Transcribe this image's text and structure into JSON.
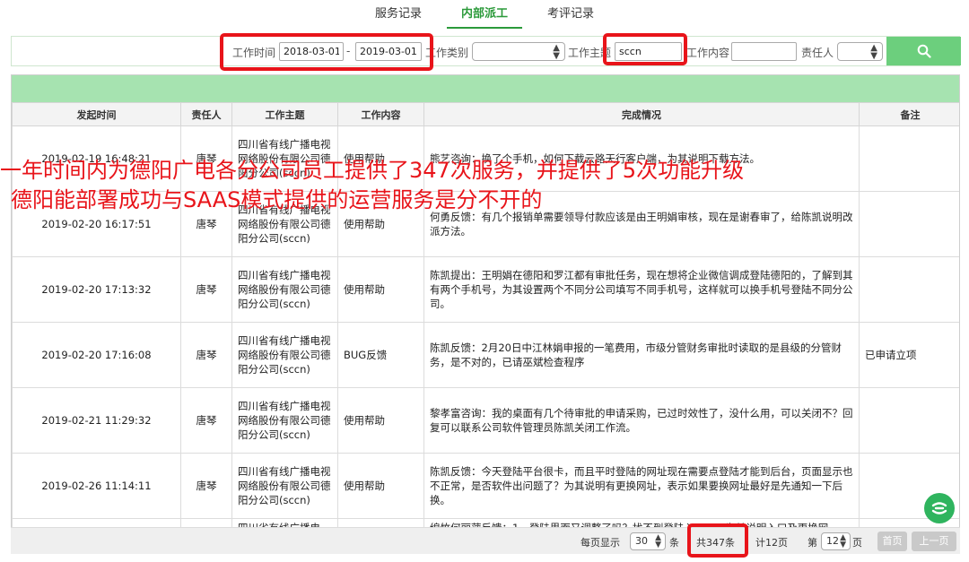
{
  "tabs": [
    {
      "label": "服务记录",
      "active": false
    },
    {
      "label": "内部派工",
      "active": true
    },
    {
      "label": "考评记录",
      "active": false
    }
  ],
  "filters": {
    "work_time_label": "工作时间",
    "date_from": "2018-03-01",
    "date_sep": "-",
    "date_to": "2019-03-01",
    "category_label": "工作类别",
    "subject_label": "工作主题",
    "subject_value": "sccn",
    "content_label": "工作内容",
    "owner_label": "责任人",
    "search_icon": "search-icon"
  },
  "table": {
    "columns": [
      "发起时间",
      "责任人",
      "工作主题",
      "工作内容",
      "完成情况",
      "备注"
    ],
    "rows": [
      {
        "time": "2019-02-19 16:48:21",
        "owner": "唐琴",
        "subject": "四川省有线广播电视网络股份有限公司德阳分公司(sccn)",
        "type": "使用帮助",
        "status": "熊艺咨询：换了个手机，如何下载云路天行客户端，为其说明下载方法。",
        "note": ""
      },
      {
        "time": "2019-02-20 16:17:51",
        "owner": "唐琴",
        "subject": "四川省有线广播电视网络股份有限公司德阳分公司(sccn)",
        "type": "使用帮助",
        "status": "何勇反馈：有几个报销单需要领导付款应该是由王明娟审核，现在是谢春审了，给陈凯说明改派方法。",
        "note": ""
      },
      {
        "time": "2019-02-20 17:13:32",
        "owner": "唐琴",
        "subject": "四川省有线广播电视网络股份有限公司德阳分公司(sccn)",
        "type": "使用帮助",
        "status": "陈凯提出：王明娟在德阳和罗江都有审批任务，现在想将企业微信调成登陆德阳的，了解到其有两个手机号，为其设置两个不同分公司填写不同手机号，这样就可以换手机号登陆不同分公司。",
        "note": ""
      },
      {
        "time": "2019-02-20 17:16:08",
        "owner": "唐琴",
        "subject": "四川省有线广播电视网络股份有限公司德阳分公司(sccn)",
        "type": "BUG反馈",
        "status": "陈凯反馈：2月20日中江林娟申报的一笔费用，市级分管财务审批时读取的是县级的分管财务，是不对的，已请巫斌检查程序",
        "note": "已申请立项"
      },
      {
        "time": "2019-02-21 11:29:32",
        "owner": "唐琴",
        "subject": "四川省有线广播电视网络股份有限公司德阳分公司(sccn)",
        "type": "使用帮助",
        "status": "黎孝富咨询：我的桌面有几个待审批的申请采购，已过时效性了，没什么用，可以关闭不？回复可以联系公司软件管理员陈凯关闭工作流。",
        "note": ""
      },
      {
        "time": "2019-02-26 11:14:11",
        "owner": "唐琴",
        "subject": "四川省有线广播电视网络股份有限公司德阳分公司(sccn)",
        "type": "使用帮助",
        "status": "陈凯反馈：今天登陆平台很卡，而且平时登陆的网址现在需要点登陆才能到后台，页面显示也不正常，是否软件出问题了？为其说明有更换网址，表示如果要换网址最好是先通知一下后换。",
        "note": ""
      },
      {
        "time": "",
        "owner": "",
        "subject": "四川省有线广播电",
        "type": "",
        "status": "绵竹何丽萍反馈：1、登陆界面又调整了吗？找不到登陆入口了。为其说明入口及更换网",
        "note": ""
      }
    ]
  },
  "overlay": {
    "line1": "一年时间内为德阳广电各分公司员工提供了347次服务，并提供了5次功能升级",
    "line2": "德阳能部署成功与SAAS模式提供的运营服务是分不开的"
  },
  "pager": {
    "per_page_label": "每页显示",
    "per_page_value": "30",
    "per_page_unit": "条",
    "total": "共347条",
    "pages": "计12页",
    "page_prefix": "第",
    "page_value": "12",
    "page_suffix": "页",
    "first_label": "首页",
    "prev_label": "上一页"
  },
  "colors": {
    "accent_green": "#2b9a3a",
    "search_button": "#6ccf7d",
    "band_green": "#a6e3b0",
    "highlight_red": "#e8141a"
  }
}
